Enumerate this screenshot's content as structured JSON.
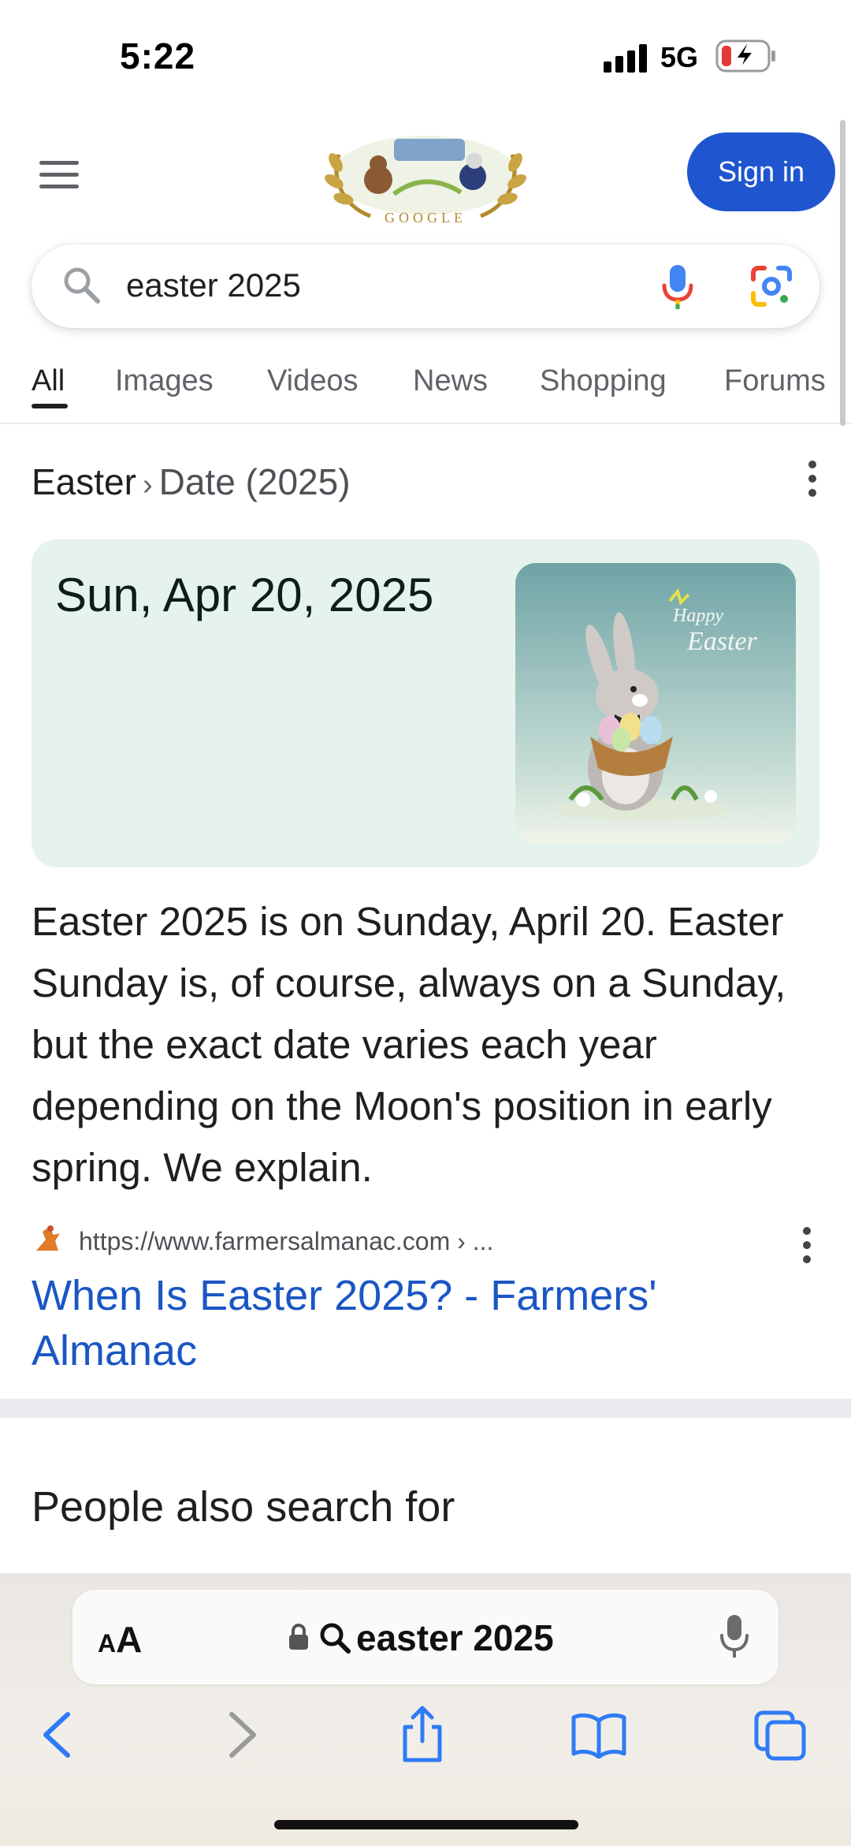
{
  "status_bar": {
    "time": "5:22",
    "network": "5G",
    "battery_state": "charging-low"
  },
  "header": {
    "sign_in_label": "Sign in",
    "doodle_text": "GOOGLE"
  },
  "search": {
    "query": "easter 2025"
  },
  "tabs": [
    {
      "label": "All",
      "selected": true
    },
    {
      "label": "Images"
    },
    {
      "label": "Videos"
    },
    {
      "label": "News"
    },
    {
      "label": "Shopping"
    },
    {
      "label": "Forums"
    }
  ],
  "breadcrumb": {
    "topic": "Easter",
    "separator": "›",
    "attribute": "Date (2025)"
  },
  "answer": {
    "date": "Sun, Apr 20, 2025",
    "image_caption_line1": "Happy",
    "image_caption_line2": "Easter"
  },
  "snippet": "Easter 2025 is on Sunday, April 20. Easter Sunday is, of course, always on a Sunday, but the exact date varies each year depending on the Moon's position in early spring. We explain.",
  "source": {
    "url": "https://www.farmersalmanac.com › ...",
    "title": "When Is Easter 2025? - Farmers' Almanac"
  },
  "people_also_search": {
    "heading": "People also search for"
  },
  "browser": {
    "text_size_label": "AA",
    "address_text": "easter 2025"
  },
  "colors": {
    "sign_in": "#1f56d0",
    "link": "#1a56c4",
    "answer_card": "#e6f3ec",
    "battery_low": "#e53935"
  },
  "icons": [
    "menu-icon",
    "search-icon",
    "mic-icon",
    "lens-icon",
    "more-vert-icon",
    "lock-icon",
    "magnifier-icon",
    "back-icon",
    "forward-icon",
    "share-icon",
    "bookmarks-icon",
    "tabs-icon"
  ]
}
